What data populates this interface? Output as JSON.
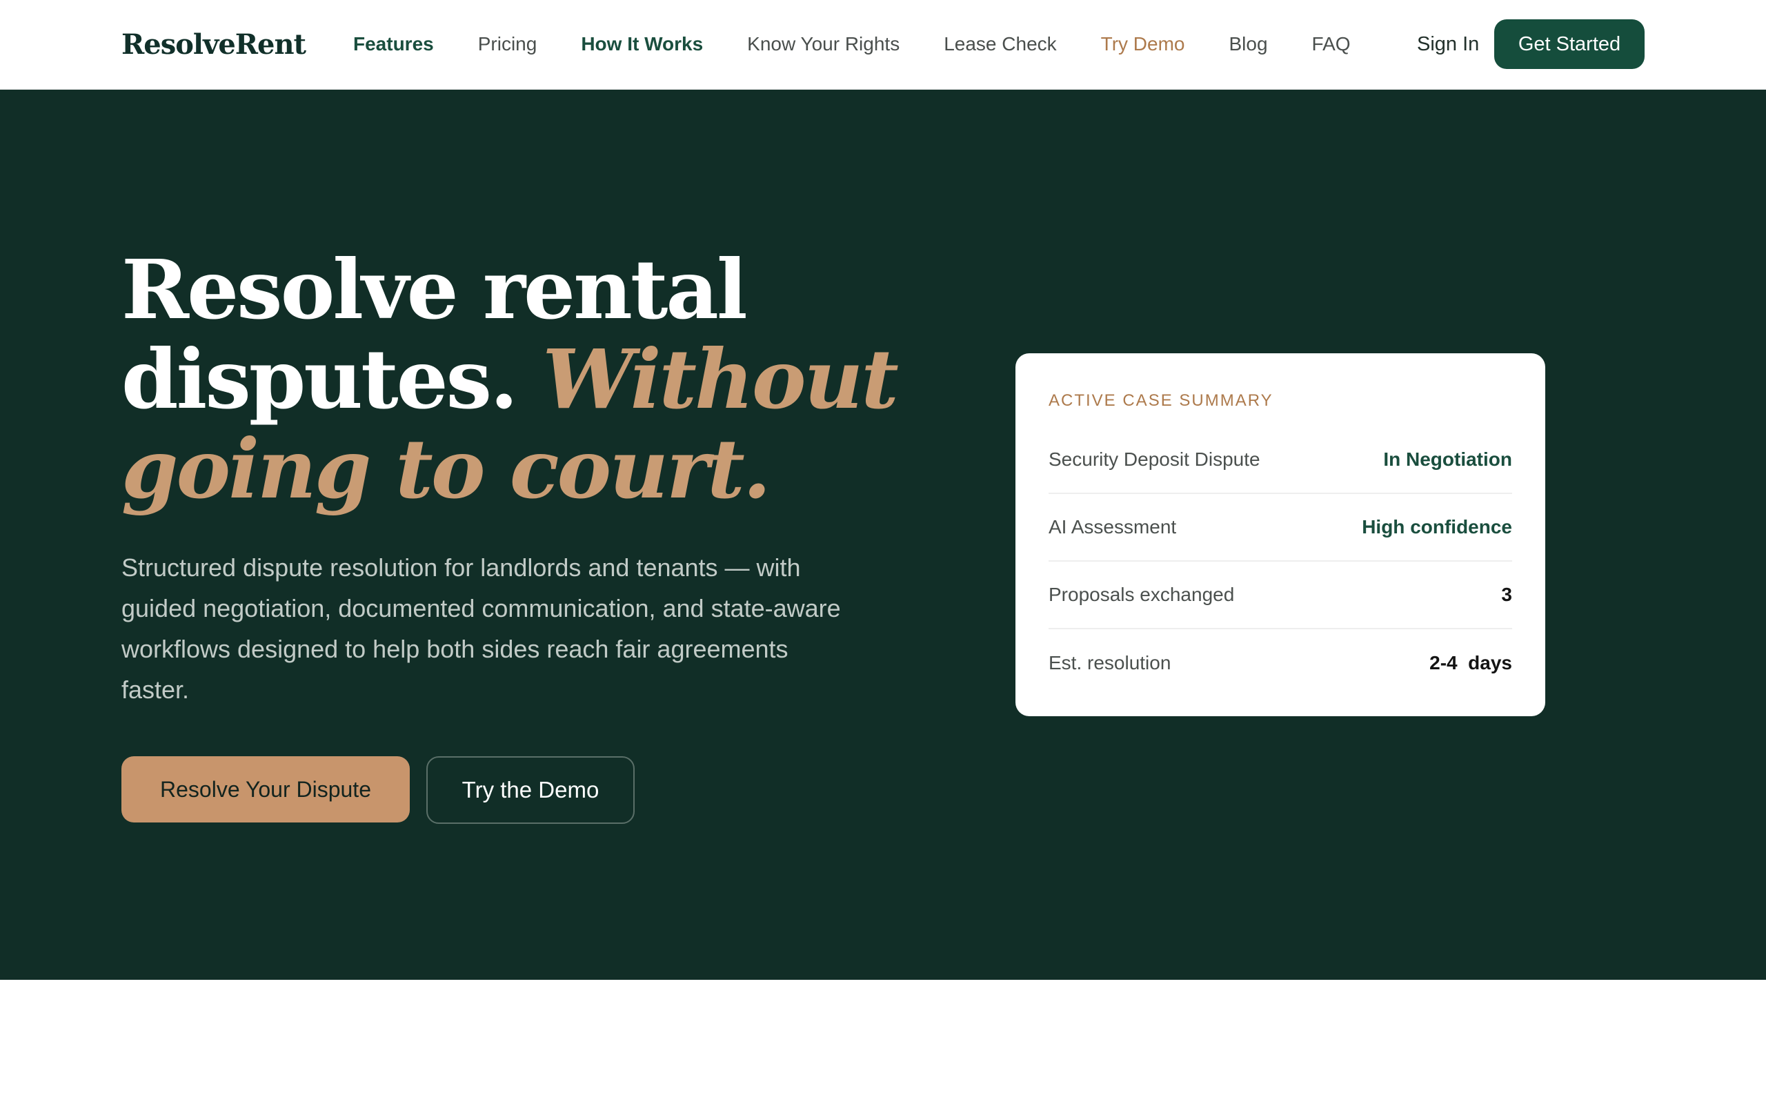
{
  "nav": {
    "brand": "ResolveRent",
    "links": [
      {
        "label": "Features"
      },
      {
        "label": "Pricing"
      },
      {
        "label": "How It Works"
      },
      {
        "label": "Know Your Rights"
      },
      {
        "label": "Lease Check"
      },
      {
        "label": "Try Demo"
      },
      {
        "label": "Blog"
      },
      {
        "label": "FAQ"
      }
    ],
    "sign_in": "Sign In",
    "get_started": "Get Started"
  },
  "hero": {
    "headline_line1": "Resolve rental",
    "headline_line2_plain": "disputes.",
    "headline_line2_em": "Without",
    "headline_line3_em": "going to court.",
    "subcopy": "Structured dispute resolution for landlords and tenants — with guided negotiation, documented communication, and state-aware workflows designed to help both sides reach fair agreements faster.",
    "primary_cta": "Resolve Your Dispute",
    "secondary_cta": "Try the Demo"
  },
  "case_card": {
    "title": "ACTIVE CASE SUMMARY",
    "rows": [
      {
        "label": "Security Deposit Dispute",
        "value": "In Negotiation"
      },
      {
        "label": "AI Assessment",
        "value": "High confidence"
      },
      {
        "label": "Proposals exchanged",
        "value": "3"
      },
      {
        "label": "Est. resolution",
        "value": "2-4  days"
      }
    ]
  },
  "colors": {
    "hero_bg": "#112e27",
    "brand_green": "#154d3c",
    "accent_tan": "#c8956c",
    "accent_text": "#ad7a4c"
  }
}
